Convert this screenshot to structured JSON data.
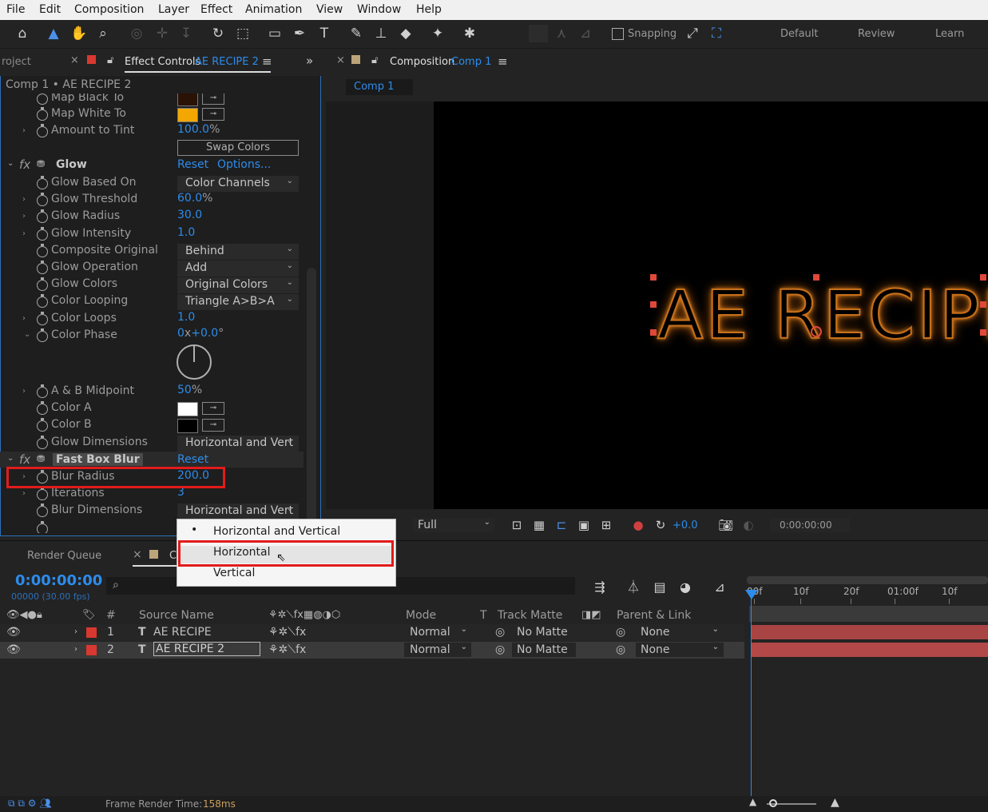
{
  "menu": [
    "File",
    "Edit",
    "Composition",
    "Layer",
    "Effect",
    "Animation",
    "View",
    "Window",
    "Help"
  ],
  "toolbar": {
    "snapping_label": "Snapping",
    "workspaces": [
      "Default",
      "Review",
      "Learn"
    ]
  },
  "left_panel": {
    "project_tab": "roject",
    "effect_controls_tab": "Effect Controls",
    "effect_controls_layer": "AE RECIPE 2",
    "breadcrumb": "Comp 1 • AE RECIPE 2"
  },
  "tint": {
    "map_black_to": "Map Black To",
    "map_white_to": "Map White To",
    "map_white_color": "#f2a800",
    "map_black_color": "#2a1206",
    "amount_to_tint": "Amount to Tint",
    "amount_to_tint_value": "100.0",
    "amount_unit": "%",
    "swap_colors": "Swap Colors"
  },
  "glow": {
    "name": "Glow",
    "reset": "Reset",
    "options": "Options...",
    "props": [
      {
        "name": "Glow Based On",
        "kind": "dropdown",
        "value": "Color Channels",
        "twirl": false
      },
      {
        "name": "Glow Threshold",
        "kind": "value",
        "value": "60.0",
        "unit": "%",
        "twirl": true
      },
      {
        "name": "Glow Radius",
        "kind": "value",
        "value": "30.0",
        "unit": "",
        "twirl": true
      },
      {
        "name": "Glow Intensity",
        "kind": "value",
        "value": "1.0",
        "unit": "",
        "twirl": true
      },
      {
        "name": "Composite Original",
        "kind": "dropdown",
        "value": "Behind",
        "twirl": false
      },
      {
        "name": "Glow Operation",
        "kind": "dropdown",
        "value": "Add",
        "twirl": false
      },
      {
        "name": "Glow Colors",
        "kind": "dropdown",
        "value": "Original Colors",
        "twirl": false
      },
      {
        "name": "Color Looping",
        "kind": "dropdown",
        "value": "Triangle A>B>A",
        "twirl": false
      },
      {
        "name": "Color Loops",
        "kind": "value",
        "value": "1.0",
        "unit": "",
        "twirl": true
      }
    ],
    "color_phase": "Color Phase",
    "color_phase_rev": "0",
    "color_phase_x": "x",
    "color_phase_deg": "+0.0",
    "color_phase_unit": "°",
    "ab_midpoint": "A & B Midpoint",
    "ab_midpoint_value": "50",
    "ab_midpoint_unit": "%",
    "color_a": "Color A",
    "color_a_value": "#ffffff",
    "color_b": "Color B",
    "color_b_value": "#000000",
    "glow_dimensions": "Glow Dimensions",
    "glow_dimensions_value": "Horizontal and Vert"
  },
  "fast_box_blur": {
    "name": "Fast Box Blur",
    "reset": "Reset",
    "blur_radius": "Blur Radius",
    "blur_radius_value": "200.0",
    "iterations": "Iterations",
    "iterations_value": "3",
    "blur_dimensions": "Blur Dimensions",
    "blur_dimensions_value": "Horizontal and Vert"
  },
  "dropdown_popup": {
    "options": [
      "Horizontal and Vertical",
      "Horizontal",
      "Vertical"
    ],
    "checked": "Horizontal and Vertical",
    "highlighted": "Horizontal",
    "bullet": "•"
  },
  "composition_panel": {
    "tab_label": "Composition",
    "comp_name": "Comp 1",
    "sub_tab": "Comp 1",
    "viewer_text": "AE RECIPE",
    "resolution": "Full",
    "exposure": "+0.0",
    "timecode": "0:00:00:00"
  },
  "timeline": {
    "render_queue_tab": "Render Queue",
    "comp_tab_fragment": "C",
    "current_time": "0:00:00:00",
    "frame_info": "00000 (30.00 fps)",
    "headers": {
      "num": "#",
      "source": "Source Name",
      "mode": "Mode",
      "t": "T",
      "track_matte": "Track Matte",
      "parent": "Parent & Link"
    },
    "ruler": [
      "00f",
      "10f",
      "20f",
      "01:00f",
      "10f"
    ],
    "layers": [
      {
        "num": "1",
        "type": "T",
        "name": "AE RECIPE",
        "mode": "Normal",
        "matte": "No Matte",
        "parent": "None",
        "selected": false
      },
      {
        "num": "2",
        "type": "T",
        "name": "AE RECIPE 2",
        "mode": "Normal",
        "matte": "No Matte",
        "parent": "None",
        "selected": true
      }
    ]
  },
  "status_bar": {
    "label": "Frame Render Time:",
    "value": "158ms"
  }
}
